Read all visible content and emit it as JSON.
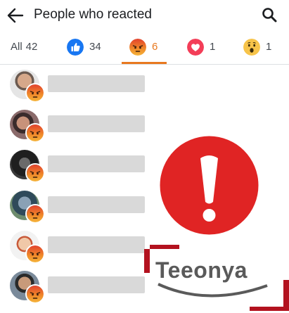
{
  "header": {
    "title": "People who reacted",
    "back_icon": "arrow-left-icon",
    "search_icon": "search-icon"
  },
  "tabs": [
    {
      "id": "all",
      "label": "All",
      "count": "42"
    },
    {
      "id": "like",
      "icon": "like-icon",
      "count": "34"
    },
    {
      "id": "angry",
      "icon": "angry-icon",
      "count": "6",
      "active": true
    },
    {
      "id": "love",
      "icon": "love-icon",
      "count": "1"
    },
    {
      "id": "wow",
      "icon": "wow-icon",
      "count": "1"
    }
  ],
  "people": [
    {
      "avatar": "avatar-photo",
      "reaction": "angry-icon"
    },
    {
      "avatar": "avatar-photo",
      "reaction": "angry-icon"
    },
    {
      "avatar": "avatar-photo",
      "reaction": "angry-icon"
    },
    {
      "avatar": "avatar-photo",
      "reaction": "angry-icon"
    },
    {
      "avatar": "avatar-photo",
      "reaction": "angry-icon"
    },
    {
      "avatar": "avatar-photo",
      "reaction": "angry-icon"
    }
  ],
  "overlay": {
    "warning_icon": "exclamation-warning-icon",
    "watermark": "Teeonya"
  },
  "colors": {
    "accent": "#e8791f",
    "like": "#1877f2",
    "love": "#f33e58",
    "warning": "#e02424",
    "placeholder": "#d9d9d9"
  }
}
